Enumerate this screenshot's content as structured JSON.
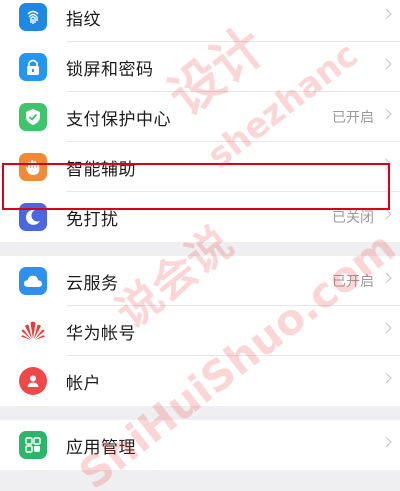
{
  "groups": [
    {
      "items": [
        {
          "label": "指纹",
          "status": "",
          "icon": "fingerprint-icon",
          "color": "#1e88e5"
        },
        {
          "label": "锁屏和密码",
          "status": "",
          "icon": "lock-icon",
          "color": "#2196f3"
        },
        {
          "label": "支付保护中心",
          "status": "已开启",
          "icon": "shield-check-icon",
          "color": "#3ec46d"
        },
        {
          "label": "智能辅助",
          "status": "",
          "icon": "hand-icon",
          "color": "#f08a36"
        },
        {
          "label": "免打扰",
          "status": "已关闭",
          "icon": "moon-icon",
          "color": "#4a67e0"
        }
      ]
    },
    {
      "items": [
        {
          "label": "云服务",
          "status": "已开启",
          "icon": "cloud-icon",
          "color": "#2f8fef"
        },
        {
          "label": "华为帐号",
          "status": "",
          "icon": "huawei-icon",
          "color": "#e83b3b"
        },
        {
          "label": "帐户",
          "status": "",
          "icon": "account-icon",
          "color": "#f04848"
        }
      ]
    },
    {
      "items": [
        {
          "label": "应用管理",
          "status": "",
          "icon": "apps-grid-icon",
          "color": "#2fb46b"
        }
      ]
    }
  ],
  "watermark": {
    "lines": [
      "设计",
      "shezhanc",
      "说会说",
      "ShiHuiShuo.com"
    ]
  }
}
